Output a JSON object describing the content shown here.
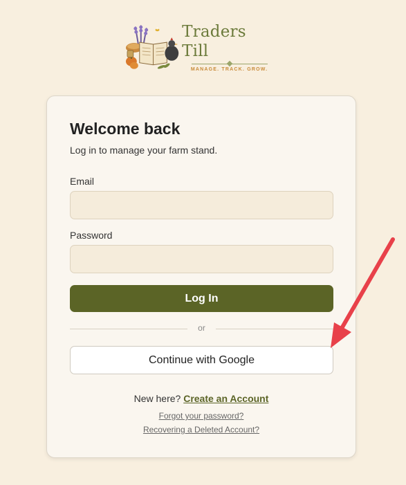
{
  "brand": {
    "name": "Traders Till",
    "tagline": "MANAGE. TRACK. GROW."
  },
  "login": {
    "title": "Welcome back",
    "subtitle": "Log in to manage your farm stand.",
    "email_label": "Email",
    "email_value": "",
    "password_label": "Password",
    "password_value": "",
    "login_button": "Log In",
    "divider_text": "or",
    "google_button": "Continue with Google",
    "new_here_text": "New here?",
    "create_account_link": "Create an Account",
    "forgot_password_link": "Forgot your password?",
    "recover_account_link": "Recovering a Deleted Account?"
  },
  "colors": {
    "background": "#f8efdf",
    "primary": "#5b6426",
    "annotation_arrow": "#e8414a"
  },
  "annotation": {
    "icon": "red-arrow-icon"
  }
}
